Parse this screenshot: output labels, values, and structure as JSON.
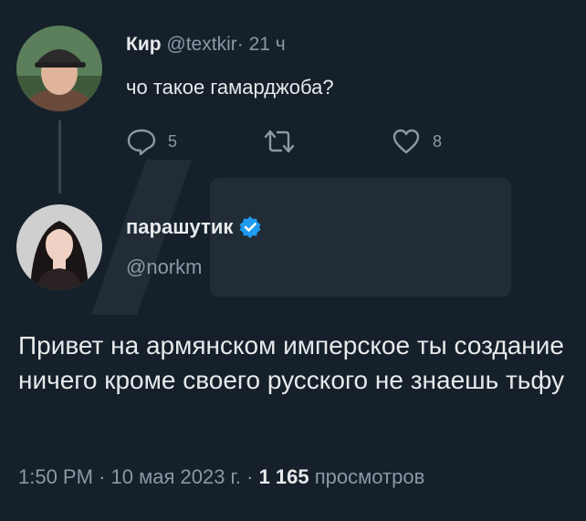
{
  "reply_to": {
    "name": "Кир",
    "handle": "@textkir",
    "separator": "·",
    "time": "21 ч",
    "text": "чо такое гамарджоба?",
    "reply_count": "5",
    "retweet_count": "",
    "like_count": "8",
    "avatar_icon": "avatar-photo-man-cap"
  },
  "tweet": {
    "name": "парашутик",
    "verified_icon": "verified-badge-icon",
    "handle": "@norkm",
    "text": "Привет на армянском имперское ты создание ничего кроме своего русского не знаешь тьфу",
    "time": "1:50 PM",
    "sep1": "·",
    "date": "10 мая 2023 г.",
    "sep2": "·",
    "views_count": "1 165",
    "views_label": "просмотров",
    "avatar_icon": "avatar-photo-woman"
  },
  "colors": {
    "background": "#15202b",
    "text": "#e7e9ea",
    "muted": "#8b98a5",
    "verified": "#1d9bf0"
  }
}
